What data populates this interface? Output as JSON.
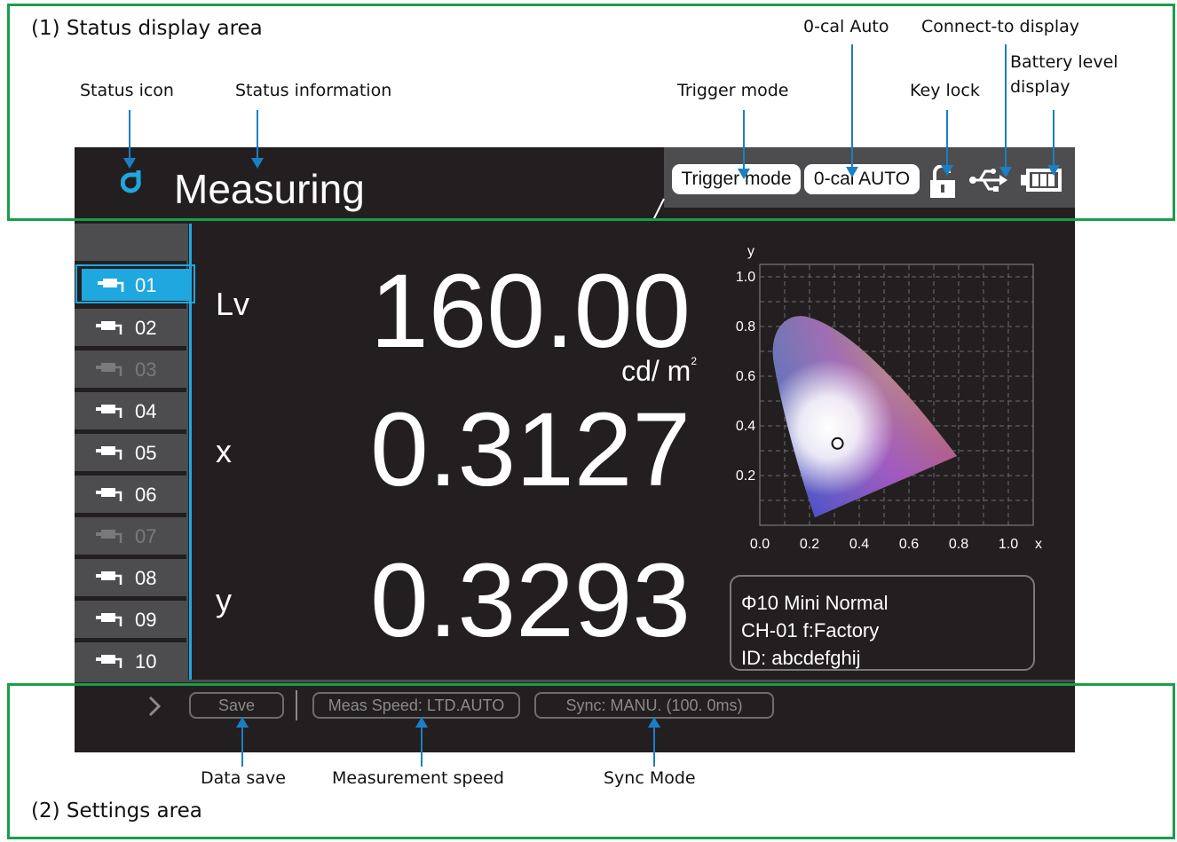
{
  "annotations": {
    "status_area_title": "(1) Status display area",
    "settings_area_title": "(2) Settings area",
    "status_icon": "Status icon",
    "status_information": "Status information",
    "trigger_mode": "Trigger mode",
    "zero_cal_auto": "0-cal Auto",
    "connect_to_display": "Connect-to display",
    "key_lock": "Key lock",
    "battery_level_line1": "Battery level",
    "battery_level_line2": "display",
    "data_save": "Data save",
    "measurement_speed": "Measurement speed",
    "sync_mode": "Sync Mode"
  },
  "status_bar": {
    "status_text": "Measuring",
    "trigger_mode_pill": "Trigger mode",
    "zero_cal_pill": "0-cal AUTO",
    "status_icon": "drop-icon",
    "key_lock_icon": "unlocked-padlock-icon",
    "connection_icon": "usb-icon",
    "battery_icon": "battery-icon"
  },
  "channels": [
    {
      "label": "01",
      "state": "selected"
    },
    {
      "label": "02",
      "state": "active"
    },
    {
      "label": "03",
      "state": "disabled"
    },
    {
      "label": "04",
      "state": "active"
    },
    {
      "label": "05",
      "state": "active"
    },
    {
      "label": "06",
      "state": "active"
    },
    {
      "label": "07",
      "state": "disabled"
    },
    {
      "label": "08",
      "state": "active"
    },
    {
      "label": "09",
      "state": "active"
    },
    {
      "label": "10",
      "state": "active"
    }
  ],
  "measurements": {
    "lv_label": "Lv",
    "lv_value": "160.00",
    "lv_unit": "cd/ m",
    "lv_unit_sup": "2",
    "x_label": "x",
    "x_value": "0.3127",
    "y_label": "y",
    "y_value": "0.3293"
  },
  "chromaticity_plot": {
    "y_axis_label": "y",
    "x_axis_label": "x",
    "y_ticks": [
      "1.0",
      "0.8",
      "0.6",
      "0.4",
      "0.2"
    ],
    "x_ticks": [
      "0.0",
      "0.2",
      "0.4",
      "0.6",
      "0.8",
      "1.0"
    ],
    "point": {
      "x": 0.3127,
      "y": 0.3293
    }
  },
  "info": {
    "line1": "Φ10 Mini Normal",
    "line2": "CH-01 f:Factory",
    "line3": "ID: abcdefghij"
  },
  "settings": {
    "save": "Save",
    "meas_speed": "Meas Speed: LTD.AUTO",
    "sync": "Sync: MANU. (100. 0ms)"
  },
  "colors": {
    "accent": "#1fa7e0",
    "frame": "#1a9d4b",
    "arrow": "#1a7fc4",
    "screen_bg": "#231f20"
  }
}
